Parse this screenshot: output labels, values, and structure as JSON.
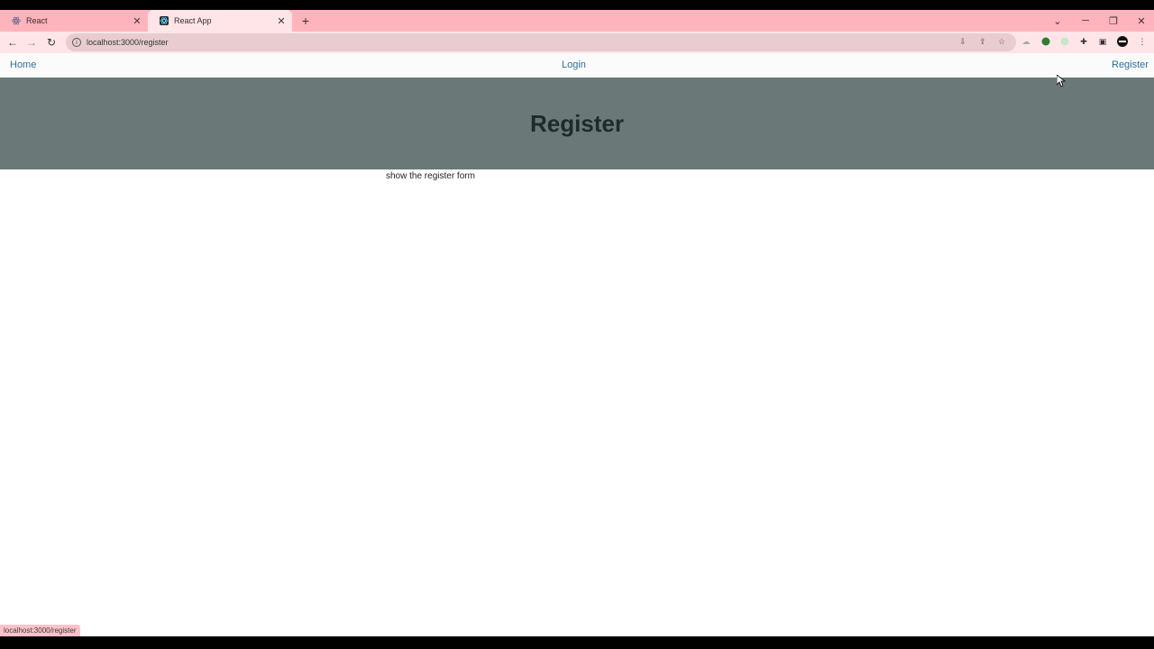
{
  "browser": {
    "tabs": [
      {
        "title": "React",
        "icon": "react-icon"
      },
      {
        "title": "React App",
        "icon": "react-icon"
      }
    ],
    "url": "localhost:3000/register",
    "status_url": "localhost:3000/register"
  },
  "nav": {
    "home": "Home",
    "login": "Login",
    "register": "Register"
  },
  "hero": {
    "title": "Register"
  },
  "content": {
    "text": "show the register form"
  },
  "colors": {
    "tabstrip": "#ffb3bc",
    "hero": "#6b7878",
    "link": "#2f6f9f"
  }
}
